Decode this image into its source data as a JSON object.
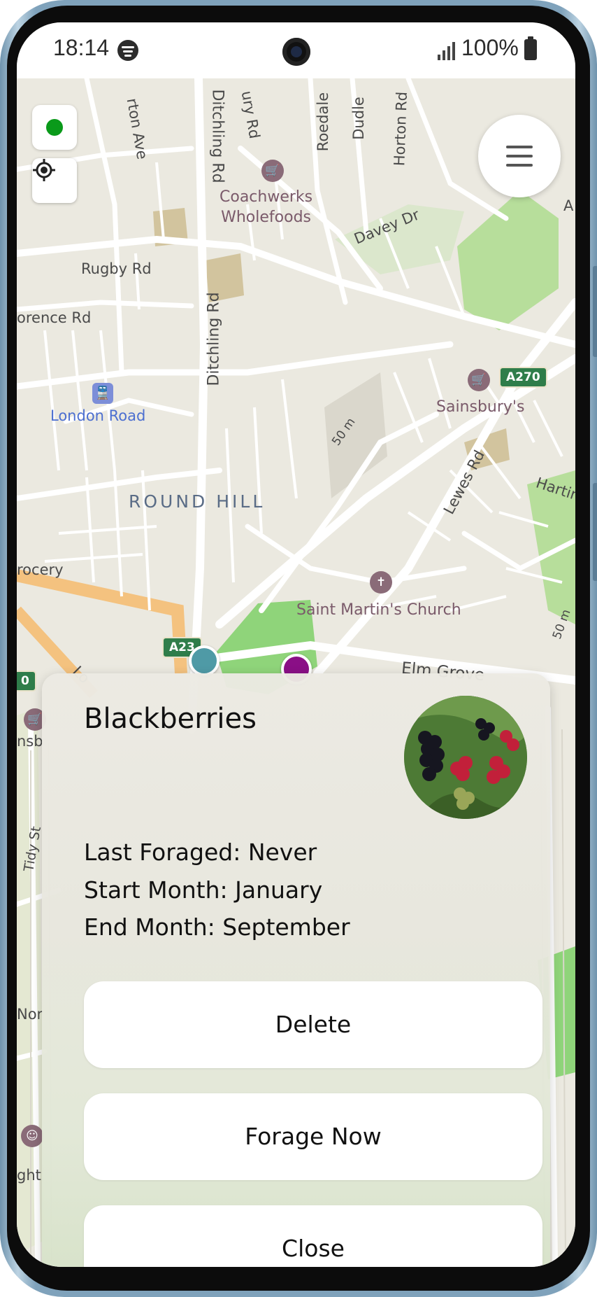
{
  "status_bar": {
    "time": "18:14",
    "battery": "100%"
  },
  "map": {
    "streets": [
      "Ditchling Rd",
      "Ditchling Rd",
      "Rugby Rd",
      "orence Rd",
      "Davey Dr",
      "Lewes Rd",
      "Elm Grove",
      "Hartin",
      "rton Ave",
      "ury Rd",
      "Roedale",
      "Dudle",
      "Horton Rd",
      "50 m",
      "50 m",
      "rocery",
      "Lo",
      "Tidy St",
      "Nor",
      "ght",
      "nsb",
      "A"
    ],
    "places": [
      "ROUND HILL"
    ],
    "pois": [
      "Coachwerks\nWholefoods",
      "Sainsbury's",
      "Saint Martin's Church"
    ],
    "stations": [
      "London Road"
    ],
    "shields": [
      "A270",
      "A23",
      "0"
    ]
  },
  "popup": {
    "title": "Blackberries",
    "last_foraged": "Last Foraged: Never",
    "start_month": "Start Month: January",
    "end_month": "End Month: September",
    "delete_label": "Delete",
    "forage_now_label": "Forage Now",
    "close_label": "Close"
  },
  "colors": {
    "status_dot": "#0a9a1a",
    "marker_teal": "#4f9aa6",
    "marker_purple": "#8a0f86"
  }
}
